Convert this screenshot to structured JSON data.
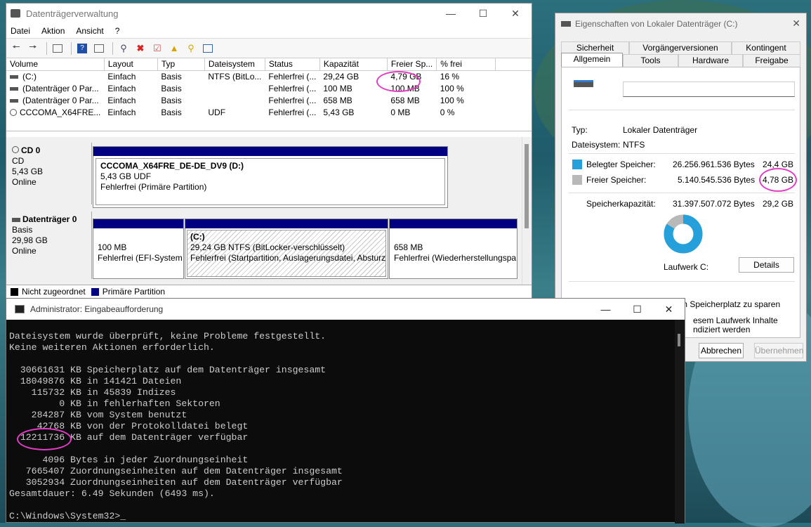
{
  "disk_mgmt": {
    "title": "Datenträgerverwaltung",
    "menu": [
      "Datei",
      "Aktion",
      "Ansicht",
      "?"
    ],
    "columns": [
      "Volume",
      "Layout",
      "Typ",
      "Dateisystem",
      "Status",
      "Kapazität",
      "Freier Sp...",
      "% frei"
    ],
    "rows": [
      [
        "(C:)",
        "Einfach",
        "Basis",
        "NTFS (BitLo...",
        "Fehlerfrei (...",
        "29,24 GB",
        "4,79 GB",
        "16 %"
      ],
      [
        "(Datenträger 0 Par...",
        "Einfach",
        "Basis",
        "",
        "Fehlerfrei (...",
        "100 MB",
        "100 MB",
        "100 %"
      ],
      [
        "(Datenträger 0 Par...",
        "Einfach",
        "Basis",
        "",
        "Fehlerfrei (...",
        "658 MB",
        "658 MB",
        "100 %"
      ],
      [
        "CCCOMA_X64FRE...",
        "Einfach",
        "Basis",
        "UDF",
        "Fehlerfrei (...",
        "5,43 GB",
        "0 MB",
        "0 %"
      ]
    ],
    "cd": {
      "name": "CD 0",
      "type": "CD",
      "size": "5,43 GB",
      "state": "Online",
      "part_name": "CCCOMA_X64FRE_DE-DE_DV9  (D:)",
      "part_size": "5,43 GB UDF",
      "part_status": "Fehlerfrei (Primäre Partition)"
    },
    "disk0": {
      "name": "Datenträger 0",
      "type": "Basis",
      "size": "29,98 GB",
      "state": "Online",
      "p1_size": "100 MB",
      "p1_status": "Fehlerfrei (EFI-System",
      "p2_name": "(C:)",
      "p2_size": "29,24 GB NTFS (BitLocker-verschlüsselt)",
      "p2_status": "Fehlerfrei (Startpartition, Auslagerungsdatei, Absturz",
      "p3_size": "658 MB",
      "p3_status": "Fehlerfrei (Wiederherstellungspa"
    },
    "legend": [
      "Nicht zugeordnet",
      "Primäre Partition"
    ]
  },
  "props": {
    "title": "Eigenschaften von Lokaler Datenträger (C:)",
    "tabs_row1": [
      "Sicherheit",
      "Vorgängerversionen",
      "Kontingent"
    ],
    "tabs_row2": [
      "Allgemein",
      "Tools",
      "Hardware",
      "Freigabe"
    ],
    "name_value": "",
    "typ_label": "Typ:",
    "typ_value": "Lokaler Datenträger",
    "fs_label": "Dateisystem:",
    "fs_value": "NTFS",
    "used_label": "Belegter Speicher:",
    "used_bytes": "26.256.961.536 Bytes",
    "used_gb": "24,4 GB",
    "free_label": "Freier Speicher:",
    "free_bytes": "5.140.545.536 Bytes",
    "free_gb": "4,78 GB",
    "cap_label": "Speicherkapazität:",
    "cap_bytes": "31.397.507.072 Bytes",
    "cap_gb": "29,2 GB",
    "drive_label": "Laufwerk C:",
    "details_button": "Details",
    "compress_label": "Laufwerk komprimieren, um Speicherplatz zu sparen",
    "index_label_1": "esem Laufwerk Inhalte",
    "index_label_2": "ndiziert werden",
    "cancel_button": "Abbrechen",
    "apply_button": "Übernehmen",
    "used_fraction": 0.836,
    "used_color": "#26a0da",
    "free_color": "#b8b8b8"
  },
  "cmd": {
    "title": "Administrator: Eingabeaufforderung",
    "lines": [
      "Dateisystem wurde überprüft, keine Probleme festgestellt.",
      "Keine weiteren Aktionen erforderlich.",
      "",
      "  30661631 KB Speicherplatz auf dem Datenträger insgesamt",
      "  18049876 KB in 141421 Dateien",
      "    115732 KB in 45839 Indizes",
      "         0 KB in fehlerhaften Sektoren",
      "    284287 KB vom System benutzt",
      "     42768 KB von der Protokolldatei belegt",
      "  12211736 KB auf dem Datenträger verfügbar",
      "",
      "      4096 Bytes in jeder Zuordnungseinheit",
      "   7665407 Zuordnungseinheiten auf dem Datenträger insgesamt",
      "   3052934 Zuordnungseinheiten auf dem Datenträger verfügbar",
      "Gesamtdauer: 6.49 Sekunden (6493 ms).",
      "",
      "C:\\Windows\\System32>"
    ]
  }
}
